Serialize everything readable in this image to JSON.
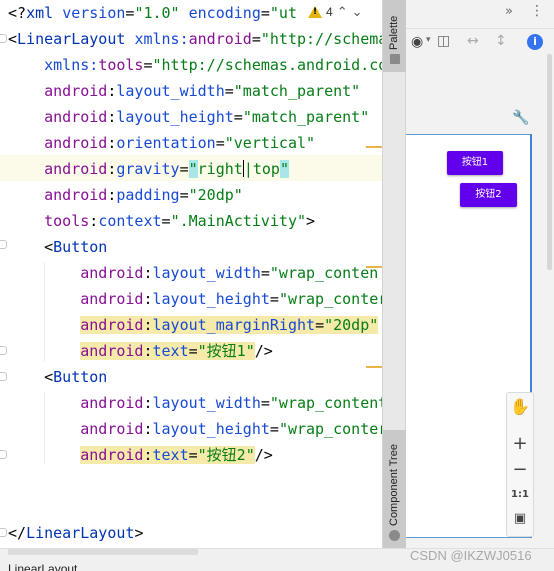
{
  "editor": {
    "lines": [
      [
        {
          "c": "t-pun",
          "t": "<?"
        },
        {
          "c": "t-tag",
          "t": "xml "
        },
        {
          "c": "t-attr",
          "t": "version"
        },
        {
          "c": "t-pun",
          "t": "="
        },
        {
          "c": "t-val",
          "t": "\"1.0\""
        },
        {
          "c": "t-pun",
          "t": " "
        },
        {
          "c": "t-attr",
          "t": "encoding"
        },
        {
          "c": "t-pun",
          "t": "="
        },
        {
          "c": "t-val",
          "t": "\"ut"
        }
      ],
      [
        {
          "c": "t-pun",
          "t": "<"
        },
        {
          "c": "t-tag",
          "t": "LinearLayout "
        },
        {
          "c": "t-attr",
          "t": "xmlns:"
        },
        {
          "c": "t-ns",
          "t": "android"
        },
        {
          "c": "t-pun",
          "t": "="
        },
        {
          "c": "t-val",
          "t": "\"http://schemas"
        }
      ],
      [
        {
          "c": "t-pun",
          "t": "    "
        },
        {
          "c": "t-attr",
          "t": "xmlns:"
        },
        {
          "c": "t-ns",
          "t": "tools"
        },
        {
          "c": "t-pun",
          "t": "="
        },
        {
          "c": "t-val",
          "t": "\"http://schemas.android.co"
        }
      ],
      [
        {
          "c": "t-pun",
          "t": "    "
        },
        {
          "c": "t-ns",
          "t": "android"
        },
        {
          "c": "t-pun",
          "t": ":"
        },
        {
          "c": "t-attr",
          "t": "layout_width"
        },
        {
          "c": "t-pun",
          "t": "="
        },
        {
          "c": "t-val",
          "t": "\"match_parent\""
        }
      ],
      [
        {
          "c": "t-pun",
          "t": "    "
        },
        {
          "c": "t-ns",
          "t": "android"
        },
        {
          "c": "t-pun",
          "t": ":"
        },
        {
          "c": "t-attr",
          "t": "layout_height"
        },
        {
          "c": "t-pun",
          "t": "="
        },
        {
          "c": "t-val",
          "t": "\"match_parent\""
        }
      ],
      [
        {
          "c": "t-pun",
          "t": "    "
        },
        {
          "c": "t-ns",
          "t": "android"
        },
        {
          "c": "t-pun",
          "t": ":"
        },
        {
          "c": "t-attr",
          "t": "orientation"
        },
        {
          "c": "t-pun",
          "t": "="
        },
        {
          "c": "t-val",
          "t": "\"vertical\""
        }
      ],
      [
        {
          "c": "t-pun",
          "t": "    "
        },
        {
          "c": "t-ns",
          "t": "android"
        },
        {
          "c": "t-pun",
          "t": ":"
        },
        {
          "c": "t-attr",
          "t": "gravity"
        },
        {
          "c": "t-pun",
          "t": "="
        },
        {
          "c": "t-val cyan",
          "t": "\""
        },
        {
          "c": "t-val",
          "t": "right"
        },
        {
          "c": "caret",
          "t": ""
        },
        {
          "c": "t-val",
          "t": "|top"
        },
        {
          "c": "t-val cyan",
          "t": "\""
        }
      ],
      [
        {
          "c": "t-pun",
          "t": "    "
        },
        {
          "c": "t-ns",
          "t": "android"
        },
        {
          "c": "t-pun",
          "t": ":"
        },
        {
          "c": "t-attr",
          "t": "padding"
        },
        {
          "c": "t-pun",
          "t": "="
        },
        {
          "c": "t-val",
          "t": "\"20dp\""
        }
      ],
      [
        {
          "c": "t-pun",
          "t": "    "
        },
        {
          "c": "t-ns",
          "t": "tools"
        },
        {
          "c": "t-pun",
          "t": ":"
        },
        {
          "c": "t-attr",
          "t": "context"
        },
        {
          "c": "t-pun",
          "t": "="
        },
        {
          "c": "t-val",
          "t": "\".MainActivity\""
        },
        {
          "c": "t-pun",
          "t": ">"
        }
      ],
      [
        {
          "c": "t-pun",
          "t": "    <"
        },
        {
          "c": "t-tag",
          "t": "Button"
        }
      ],
      [
        {
          "c": "t-pun",
          "t": "        "
        },
        {
          "c": "t-ns",
          "t": "android"
        },
        {
          "c": "t-pun",
          "t": ":"
        },
        {
          "c": "t-attr",
          "t": "layout_width"
        },
        {
          "c": "t-pun",
          "t": "="
        },
        {
          "c": "t-val",
          "t": "\"wrap_conten"
        }
      ],
      [
        {
          "c": "t-pun",
          "t": "        "
        },
        {
          "c": "t-ns",
          "t": "android"
        },
        {
          "c": "t-pun",
          "t": ":"
        },
        {
          "c": "t-attr",
          "t": "layout_height"
        },
        {
          "c": "t-pun",
          "t": "="
        },
        {
          "c": "t-val",
          "t": "\"wrap_conter"
        }
      ],
      [
        {
          "c": "t-pun",
          "t": "        "
        },
        {
          "c": "t-ns mark",
          "t": "android"
        },
        {
          "c": "t-pun mark",
          "t": ":"
        },
        {
          "c": "t-attr mark",
          "t": "layout_marginRight"
        },
        {
          "c": "t-pun mark",
          "t": "="
        },
        {
          "c": "t-val mark",
          "t": "\"20dp\""
        }
      ],
      [
        {
          "c": "t-pun",
          "t": "        "
        },
        {
          "c": "t-ns mark",
          "t": "android"
        },
        {
          "c": "t-pun mark",
          "t": ":"
        },
        {
          "c": "t-attr mark",
          "t": "text"
        },
        {
          "c": "t-pun mark",
          "t": "="
        },
        {
          "c": "t-val mark",
          "t": "\"按钮1\""
        },
        {
          "c": "t-pun",
          "t": "/>"
        }
      ],
      [
        {
          "c": "t-pun",
          "t": "    <"
        },
        {
          "c": "t-tag",
          "t": "Button"
        }
      ],
      [
        {
          "c": "t-pun",
          "t": "        "
        },
        {
          "c": "t-ns",
          "t": "android"
        },
        {
          "c": "t-pun",
          "t": ":"
        },
        {
          "c": "t-attr",
          "t": "layout_width"
        },
        {
          "c": "t-pun",
          "t": "="
        },
        {
          "c": "t-val",
          "t": "\"wrap_content"
        }
      ],
      [
        {
          "c": "t-pun",
          "t": "        "
        },
        {
          "c": "t-ns",
          "t": "android"
        },
        {
          "c": "t-pun",
          "t": ":"
        },
        {
          "c": "t-attr",
          "t": "layout_height"
        },
        {
          "c": "t-pun",
          "t": "="
        },
        {
          "c": "t-val",
          "t": "\"wrap_conter"
        }
      ],
      [
        {
          "c": "t-pun",
          "t": "        "
        },
        {
          "c": "t-ns mark",
          "t": "android"
        },
        {
          "c": "t-pun mark",
          "t": ":"
        },
        {
          "c": "t-attr mark",
          "t": "text"
        },
        {
          "c": "t-pun mark",
          "t": "="
        },
        {
          "c": "t-val mark",
          "t": "\"按钮2\""
        },
        {
          "c": "t-pun",
          "t": "/>"
        }
      ],
      [],
      [],
      [
        {
          "c": "t-pun",
          "t": "</"
        },
        {
          "c": "t-tag",
          "t": "LinearLayout"
        },
        {
          "c": "t-pun",
          "t": ">"
        }
      ]
    ],
    "inspection_count": "4",
    "inspection_warning_symbol": "!"
  },
  "side_tabs": {
    "palette": "Palette",
    "component_tree": "Component Tree"
  },
  "preview": {
    "button1": "按钮1",
    "button2": "按钮2",
    "zoom_ratio": "1:1"
  },
  "bottom": {
    "label": "LinearLayout",
    "watermark": "CSDN @IKZWJ0516"
  },
  "colors": {
    "button": "#6200ee",
    "device_border": "#3c82d6"
  }
}
